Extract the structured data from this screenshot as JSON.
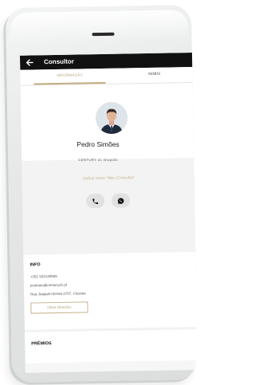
{
  "app_bar": {
    "title": "Consultor",
    "back_icon": "arrow-left-icon"
  },
  "tabs": [
    {
      "label": "INFORMAÇÃO",
      "active": true
    },
    {
      "label": "NOBIS",
      "active": false
    }
  ],
  "profile": {
    "name": "Pedro Simões",
    "agency": "CENTURY 21 Imopolis"
  },
  "actions": {
    "define_link": "Definir como “Meu Consultor”",
    "phone_icon": "phone-icon",
    "whatsapp_icon": "whatsapp-icon"
  },
  "info": {
    "title": "INFO",
    "phone": "+351 933148565",
    "email": "psimoes@century21.pt",
    "address": "Rua Joaquim Ereira 2707, Cascais",
    "directions_label": "Obter Direções"
  },
  "awards": {
    "title": "PRÉMIOS"
  },
  "colors": {
    "accent_gold": "#c4ad83",
    "appbar_black": "#111111",
    "screen_grey": "#f3f3f3"
  }
}
